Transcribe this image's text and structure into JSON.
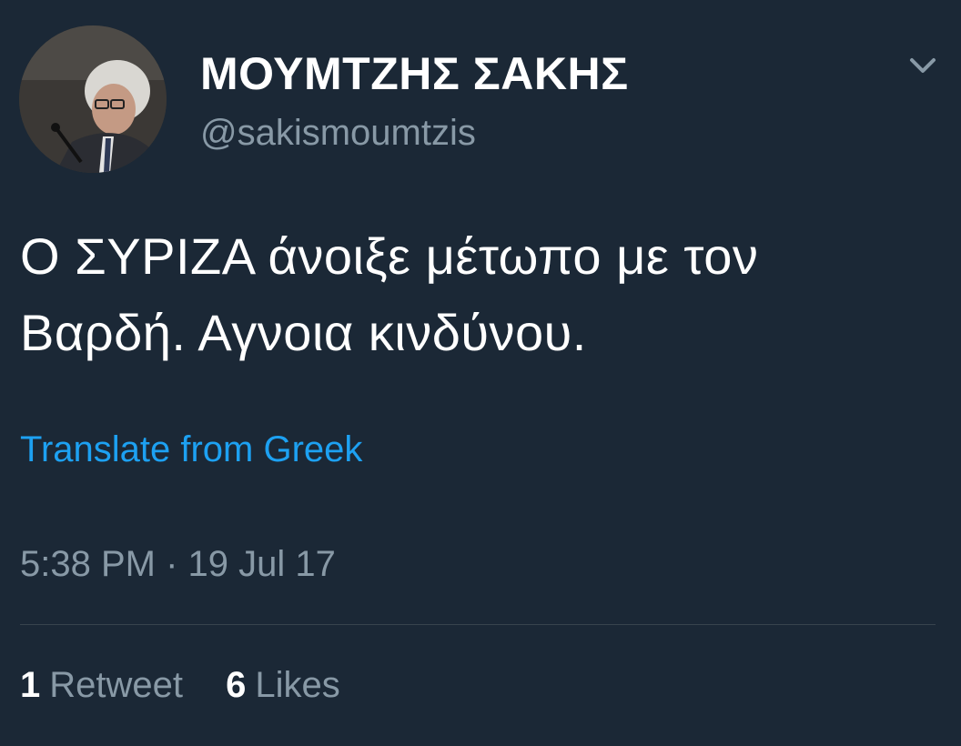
{
  "author": {
    "display_name": "ΜΟΥΜΤΖΗΣ ΣΑΚΗΣ",
    "handle": "@sakismoumtzis"
  },
  "tweet": {
    "text_line1": "Ο ΣΥΡΙΖΑ άνοιξε μέτωπο με τον",
    "text_line2": "Βαρδή. Αγνοια κινδύνου.",
    "translate_label": "Translate from Greek",
    "timestamp": "5:38 PM · 19 Jul 17"
  },
  "stats": {
    "retweets_count": "1",
    "retweets_label": "Retweet",
    "likes_count": "6",
    "likes_label": "Likes"
  },
  "icons": {
    "menu": "chevron-down-icon"
  },
  "colors": {
    "background": "#1b2836",
    "secondary_text": "#8899a6",
    "link": "#1da1f2",
    "divider": "#38444d"
  }
}
